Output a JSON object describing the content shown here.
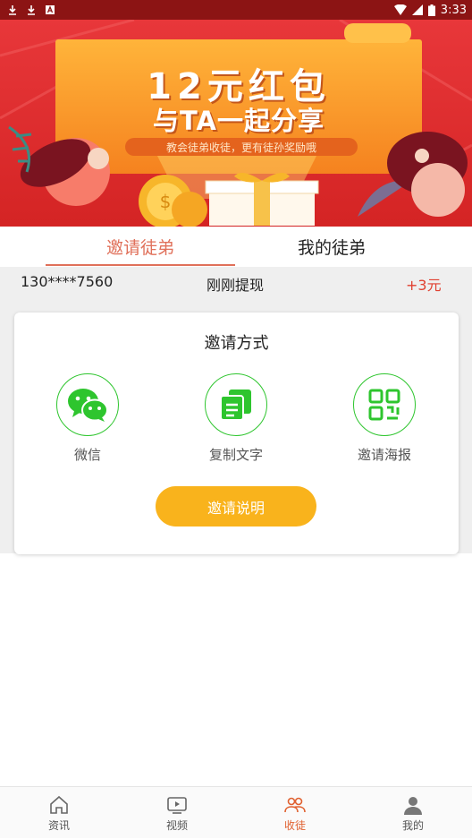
{
  "status_bar": {
    "time": "3:33"
  },
  "banner": {
    "headline_line1": "12元红包",
    "headline_line2": "与TA一起分享",
    "subline": "教会徒弟收徒，更有徒孙奖励哦",
    "bg_color": "#e02d2d"
  },
  "tabs": [
    {
      "label": "邀请徒弟",
      "active": true
    },
    {
      "label": "我的徒弟",
      "active": false
    }
  ],
  "ticker": {
    "phone": "130****7560",
    "action": "刚刚提现",
    "amount": "+3元"
  },
  "invite": {
    "title": "邀请方式",
    "options": [
      {
        "label": "微信",
        "icon": "wechat-icon"
      },
      {
        "label": "复制文字",
        "icon": "copy-icon"
      },
      {
        "label": "邀请海报",
        "icon": "qr-code-icon"
      }
    ],
    "explain_button": "邀请说明"
  },
  "bottom_nav": [
    {
      "label": "资讯",
      "icon": "home-icon",
      "active": false
    },
    {
      "label": "视频",
      "icon": "video-icon",
      "active": false
    },
    {
      "label": "收徒",
      "icon": "group-icon",
      "active": true
    },
    {
      "label": "我的",
      "icon": "user-icon",
      "active": false
    }
  ],
  "colors": {
    "accent": "#e0705a",
    "green": "#2ec52e",
    "button": "#f9b31c",
    "status_bar": "#8c1414"
  }
}
